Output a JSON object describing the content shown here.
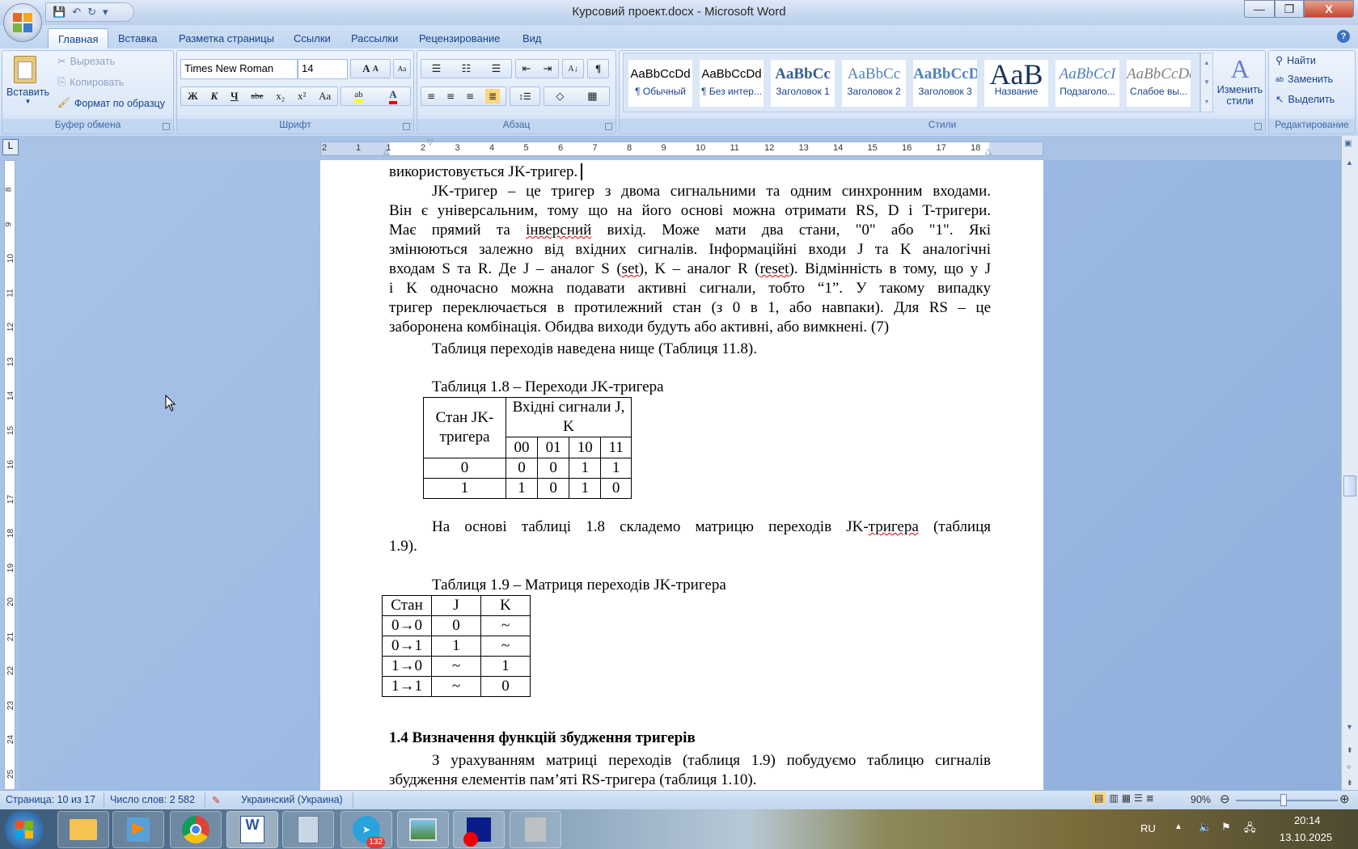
{
  "window": {
    "title": "Курсовий проект.docx - Microsoft Word",
    "minimize": "—",
    "restore": "❐",
    "close": "X",
    "help": "?"
  },
  "qat": {
    "save": "💾",
    "undo": "↶",
    "redo": "↻",
    "more": "▾"
  },
  "tabs": [
    "Главная",
    "Вставка",
    "Разметка страницы",
    "Ссылки",
    "Рассылки",
    "Рецензирование",
    "Вид"
  ],
  "clipboard": {
    "paste": "Вставить",
    "cut": "Вырезать",
    "copy": "Копировать",
    "format_painter": "Формат по образцу",
    "label": "Буфер обмена"
  },
  "font": {
    "name": "Times New Roman",
    "size": "14",
    "grow": "A",
    "shrink": "A",
    "clear": "Aa",
    "bold": "Ж",
    "italic": "К",
    "underline": "Ч",
    "strike": "abe",
    "sub": "x₂",
    "sup": "x²",
    "case": "Аа",
    "highlight": "ab",
    "color": "A",
    "label": "Шрифт"
  },
  "paragraph": {
    "bullets": "☰",
    "numbering": "☷",
    "multilevel": "☰",
    "outdent": "⇤",
    "indent": "⇥",
    "sort": "A↓",
    "pilcrow": "¶",
    "line_spacing": "↕☰",
    "shading": "◇",
    "borders": "▦",
    "label": "Абзац"
  },
  "styles": {
    "items": [
      {
        "preview": "AaBbCcDd",
        "name": "¶ Обычный",
        "color": "#000000"
      },
      {
        "preview": "AaBbCcDd",
        "name": "¶ Без интер...",
        "color": "#000000"
      },
      {
        "preview": "AaBbCc",
        "name": "Заголовок 1",
        "color": "#365f91"
      },
      {
        "preview": "AaBbCc",
        "name": "Заголовок 2",
        "color": "#4f81bd"
      },
      {
        "preview": "AaBbCcD",
        "name": "Заголовок 3",
        "color": "#4f81bd"
      },
      {
        "preview": "AaB",
        "name": "Название",
        "color": "#17365d"
      },
      {
        "preview": "AaBbCcI",
        "name": "Подзаголо...",
        "color": "#4f81bd"
      },
      {
        "preview": "AaBbCcDd",
        "name": "Слабое вы...",
        "color": "#808080"
      }
    ],
    "change": "Изменить стили",
    "label": "Стили"
  },
  "editing": {
    "find": "Найти",
    "replace": "Заменить",
    "select": "Выделить",
    "label": "Редактирование"
  },
  "ruler": {
    "h": [
      "2",
      "1",
      "1",
      "2",
      "3",
      "4",
      "5",
      "6",
      "7",
      "8",
      "9",
      "10",
      "11",
      "12",
      "13",
      "14",
      "15",
      "16",
      "17",
      "18"
    ],
    "v": [
      "8",
      "9",
      "10",
      "11",
      "12",
      "13",
      "14",
      "15",
      "16",
      "17",
      "18",
      "19",
      "20",
      "21",
      "22",
      "23",
      "24",
      "25"
    ]
  },
  "doc": {
    "line0": "використовується JK-тригер.",
    "para1": [
      "JK-тригер – це тригер з двома сигнальними та одним синхронним входами.",
      "Він є універсальним, тому що на його основі можна отримати RS, D і T-тригери.",
      [
        "Має прямий та ",
        "інверсний",
        " вихід. Може мати два стани, \"0\" або \"1\". Які"
      ],
      "змінюються залежно від вхідних сигналів. Інформаційні входи J та K аналогічні",
      [
        "входам S та R. Де J – аналог S (",
        "set",
        "), K – аналог R (",
        "reset",
        "). Відмінність в тому, що у J"
      ],
      "і K одночасно можна подавати активні сигнали, тобто “1”. У такому випадку",
      "тригер переключається в протилежний стан (з 0 в 1, або навпаки). Для RS – це",
      "заборонена комбінація. Обидва виходи будуть або активні, або вимкнені. (7)"
    ],
    "line_ref": "Таблиця переходів наведена нище (Таблиця 11.8).",
    "table18": {
      "caption": "Таблиця 1.8 – Переходи JK-тригера",
      "h1": "Стан JK-тригера",
      "h2": "Вхідні сигнали J, K",
      "cols": [
        "00",
        "01",
        "10",
        "11"
      ],
      "rows": [
        [
          "0",
          "0",
          "0",
          "1",
          "1"
        ],
        [
          "1",
          "1",
          "0",
          "1",
          "0"
        ]
      ]
    },
    "para2": [
      "На основі таблиці 1.8 складемо матрицю переходів JK-",
      "тригера",
      " (таблиця",
      "1.9)."
    ],
    "table19": {
      "caption": "Таблиця 1.9 – Матриця переходів JK-тригера",
      "header": [
        "Стан",
        "J",
        "K"
      ],
      "rows": [
        [
          "0→0",
          "0",
          "~"
        ],
        [
          "0→1",
          "1",
          "~"
        ],
        [
          "1→0",
          "~",
          "1"
        ],
        [
          "1→1",
          "~",
          "0"
        ]
      ]
    },
    "heading": "1.4 Визначення функцій збудження тригерів",
    "para3": [
      "З урахуванням матриці переходів (таблиця 1.9) побудуємо таблицю сигналів",
      "збудження елементів пам’яті RS-тригера (таблиця 1.10)."
    ]
  },
  "status": {
    "page": "Страница: 10 из 17",
    "words": "Число слов: 2 582",
    "language": "Украинский (Украина)",
    "zoom": "90%",
    "zoom_level": 0.9
  },
  "taskbar": {
    "telegram_badge": "132",
    "lang": "RU",
    "time": "20:14",
    "date": "13.10.2025"
  }
}
